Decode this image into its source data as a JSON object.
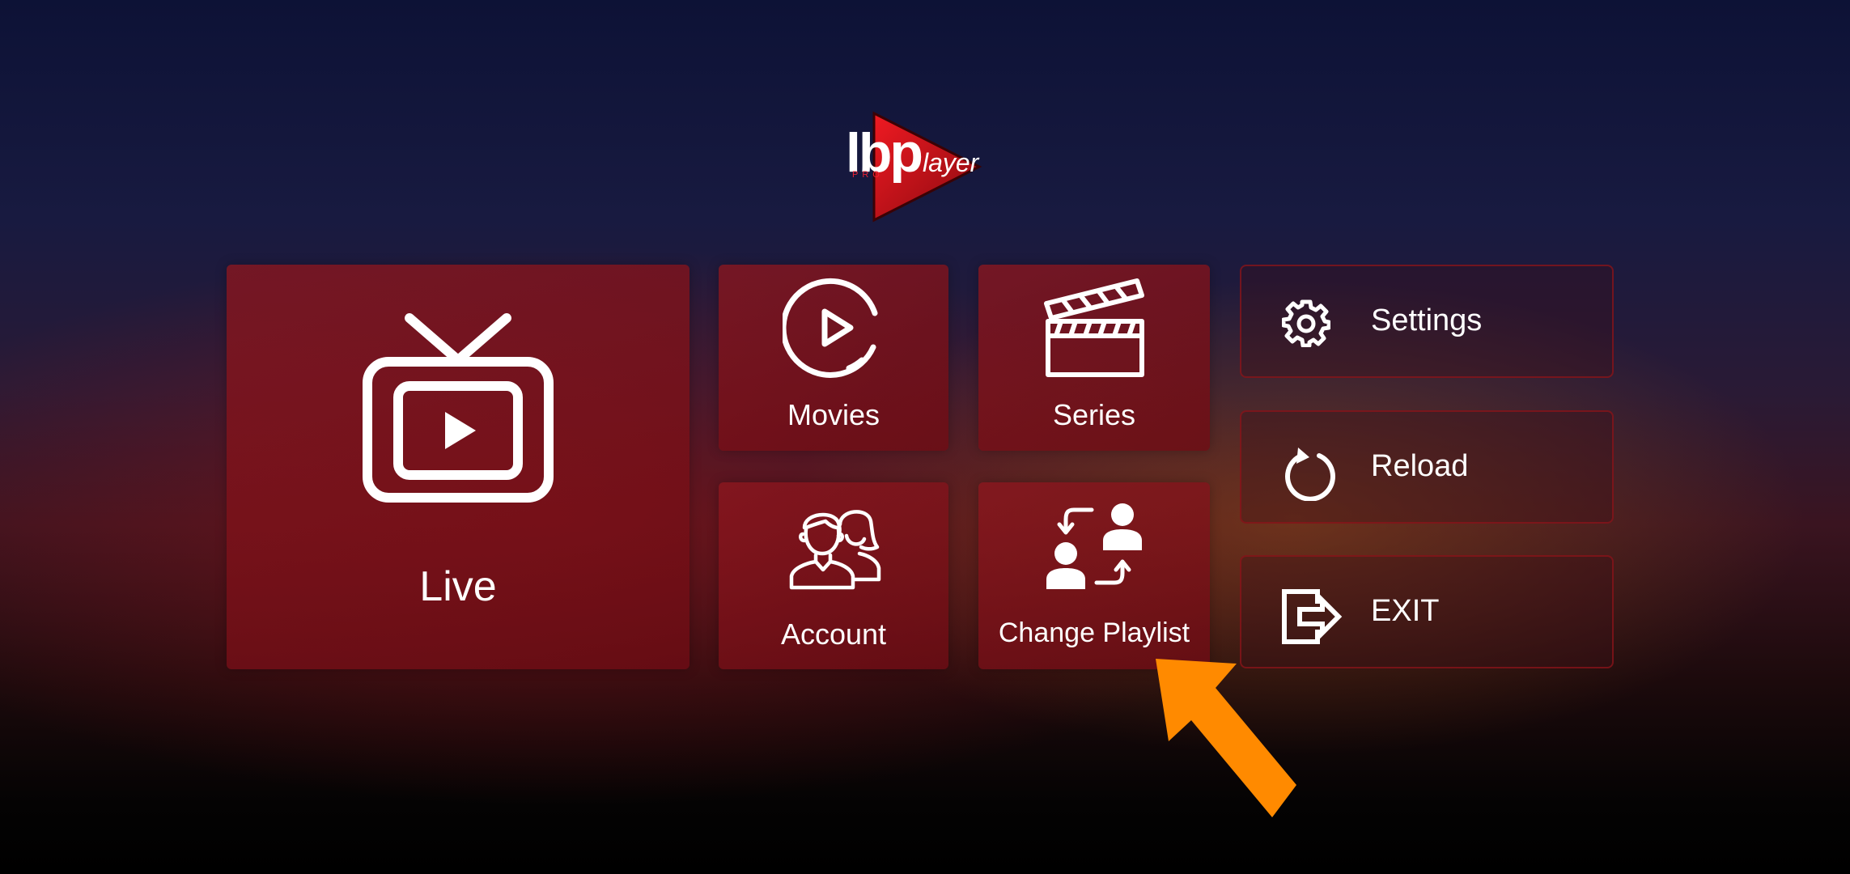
{
  "app": {
    "logo_text_main": "lbp",
    "logo_text_sub": "layer",
    "logo_text_pro": "PRO"
  },
  "tiles": {
    "live": {
      "label": "Live",
      "icon": "tv-play-icon"
    },
    "movies": {
      "label": "Movies",
      "icon": "play-circle-icon"
    },
    "series": {
      "label": "Series",
      "icon": "clapperboard-icon"
    },
    "account": {
      "label": "Account",
      "icon": "users-icon"
    },
    "change_playlist": {
      "label": "Change Playlist",
      "icon": "swap-users-icon"
    }
  },
  "side_buttons": {
    "settings": {
      "label": "Settings",
      "icon": "gear-icon"
    },
    "reload": {
      "label": "Reload",
      "icon": "reload-icon"
    },
    "exit": {
      "label": "EXIT",
      "icon": "exit-icon"
    }
  },
  "colors": {
    "tile_bg": "#8c161e",
    "side_border": "#8c1419",
    "arrow": "#ff8a00",
    "logo_red": "#d0141e"
  }
}
